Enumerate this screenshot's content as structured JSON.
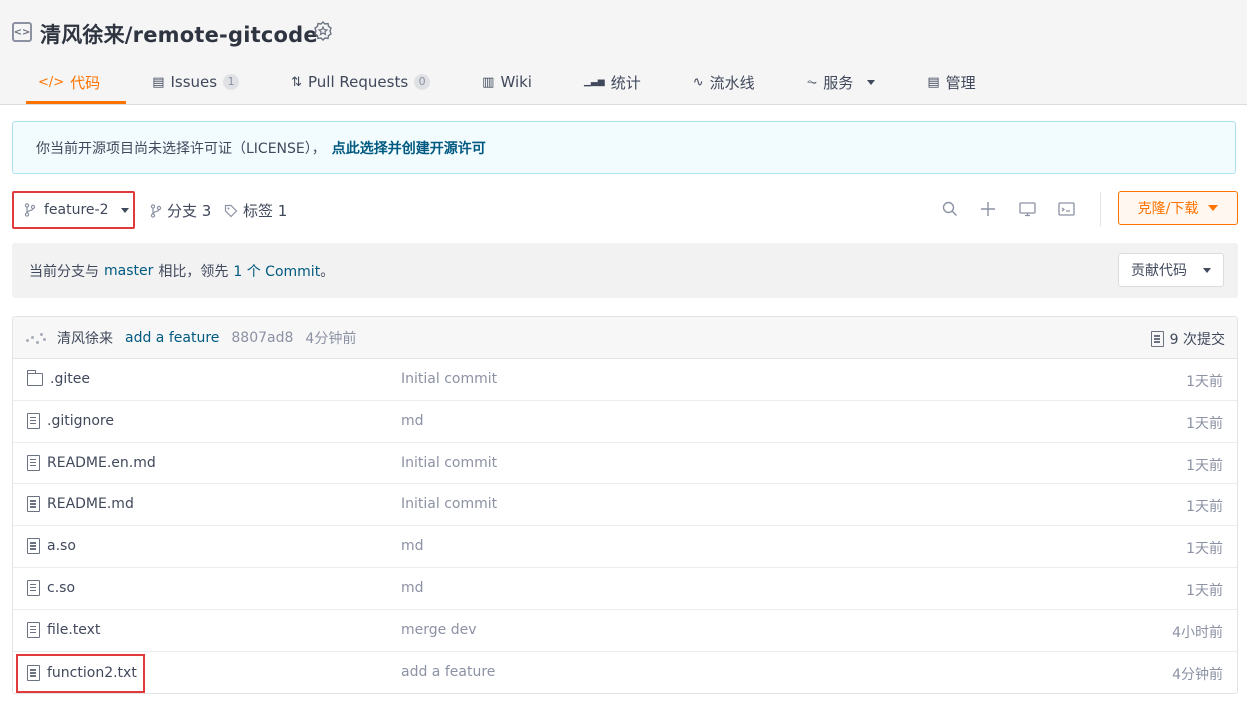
{
  "repo": {
    "title": "清风徐来/remote-gitcode"
  },
  "tabs": [
    {
      "icon": "</>",
      "label": "代码",
      "count": null
    },
    {
      "icon": "▤",
      "label": "Issues",
      "count": "1"
    },
    {
      "icon": "⇅",
      "label": "Pull Requests",
      "count": "0"
    },
    {
      "icon": "▥",
      "label": "Wiki",
      "count": null
    },
    {
      "icon": "▁▃▅",
      "label": "统计",
      "count": null
    },
    {
      "icon": "∿",
      "label": "流水线",
      "count": null
    },
    {
      "icon": "⏦",
      "label": "服务",
      "count": null
    },
    {
      "icon": "▤",
      "label": "管理",
      "count": null
    }
  ],
  "notice": {
    "text": "你当前开源项目尚未选择许可证（LICENSE），",
    "link": "点此选择并创建开源许可"
  },
  "branch_bar": {
    "current_branch": "feature-2",
    "branches": "分支 3",
    "tags": "标签 1",
    "clone_label": "克隆/下载"
  },
  "compare": {
    "prefix": "当前分支与",
    "base": "master",
    "middle": "相比，领先",
    "ahead": "1 个 Commit",
    "suffix": "。",
    "contribute_label": "贡献代码"
  },
  "last_commit": {
    "author": "清风徐来",
    "message": "add a feature",
    "sha": "8807ad8",
    "time": "4分钟前",
    "commit_count": "9 次提交"
  },
  "files": [
    {
      "type": "folder",
      "name": ".gitee",
      "message": "Initial commit",
      "time": "1天前"
    },
    {
      "type": "file",
      "name": ".gitignore",
      "message": "md",
      "time": "1天前"
    },
    {
      "type": "file",
      "name": "README.en.md",
      "message": "Initial commit",
      "time": "1天前"
    },
    {
      "type": "file",
      "name": "README.md",
      "message": "Initial commit",
      "time": "1天前"
    },
    {
      "type": "file",
      "name": "a.so",
      "message": "md",
      "time": "1天前"
    },
    {
      "type": "file",
      "name": "c.so",
      "message": "md",
      "time": "1天前"
    },
    {
      "type": "file",
      "name": "file.text",
      "message": "merge dev",
      "time": "4小时前"
    },
    {
      "type": "file",
      "name": "function2.txt",
      "message": "add a feature",
      "time": "4分钟前"
    }
  ],
  "colors": {
    "accent": "#fe7300",
    "link": "#005980",
    "highlight_box": "#e03a3a"
  }
}
